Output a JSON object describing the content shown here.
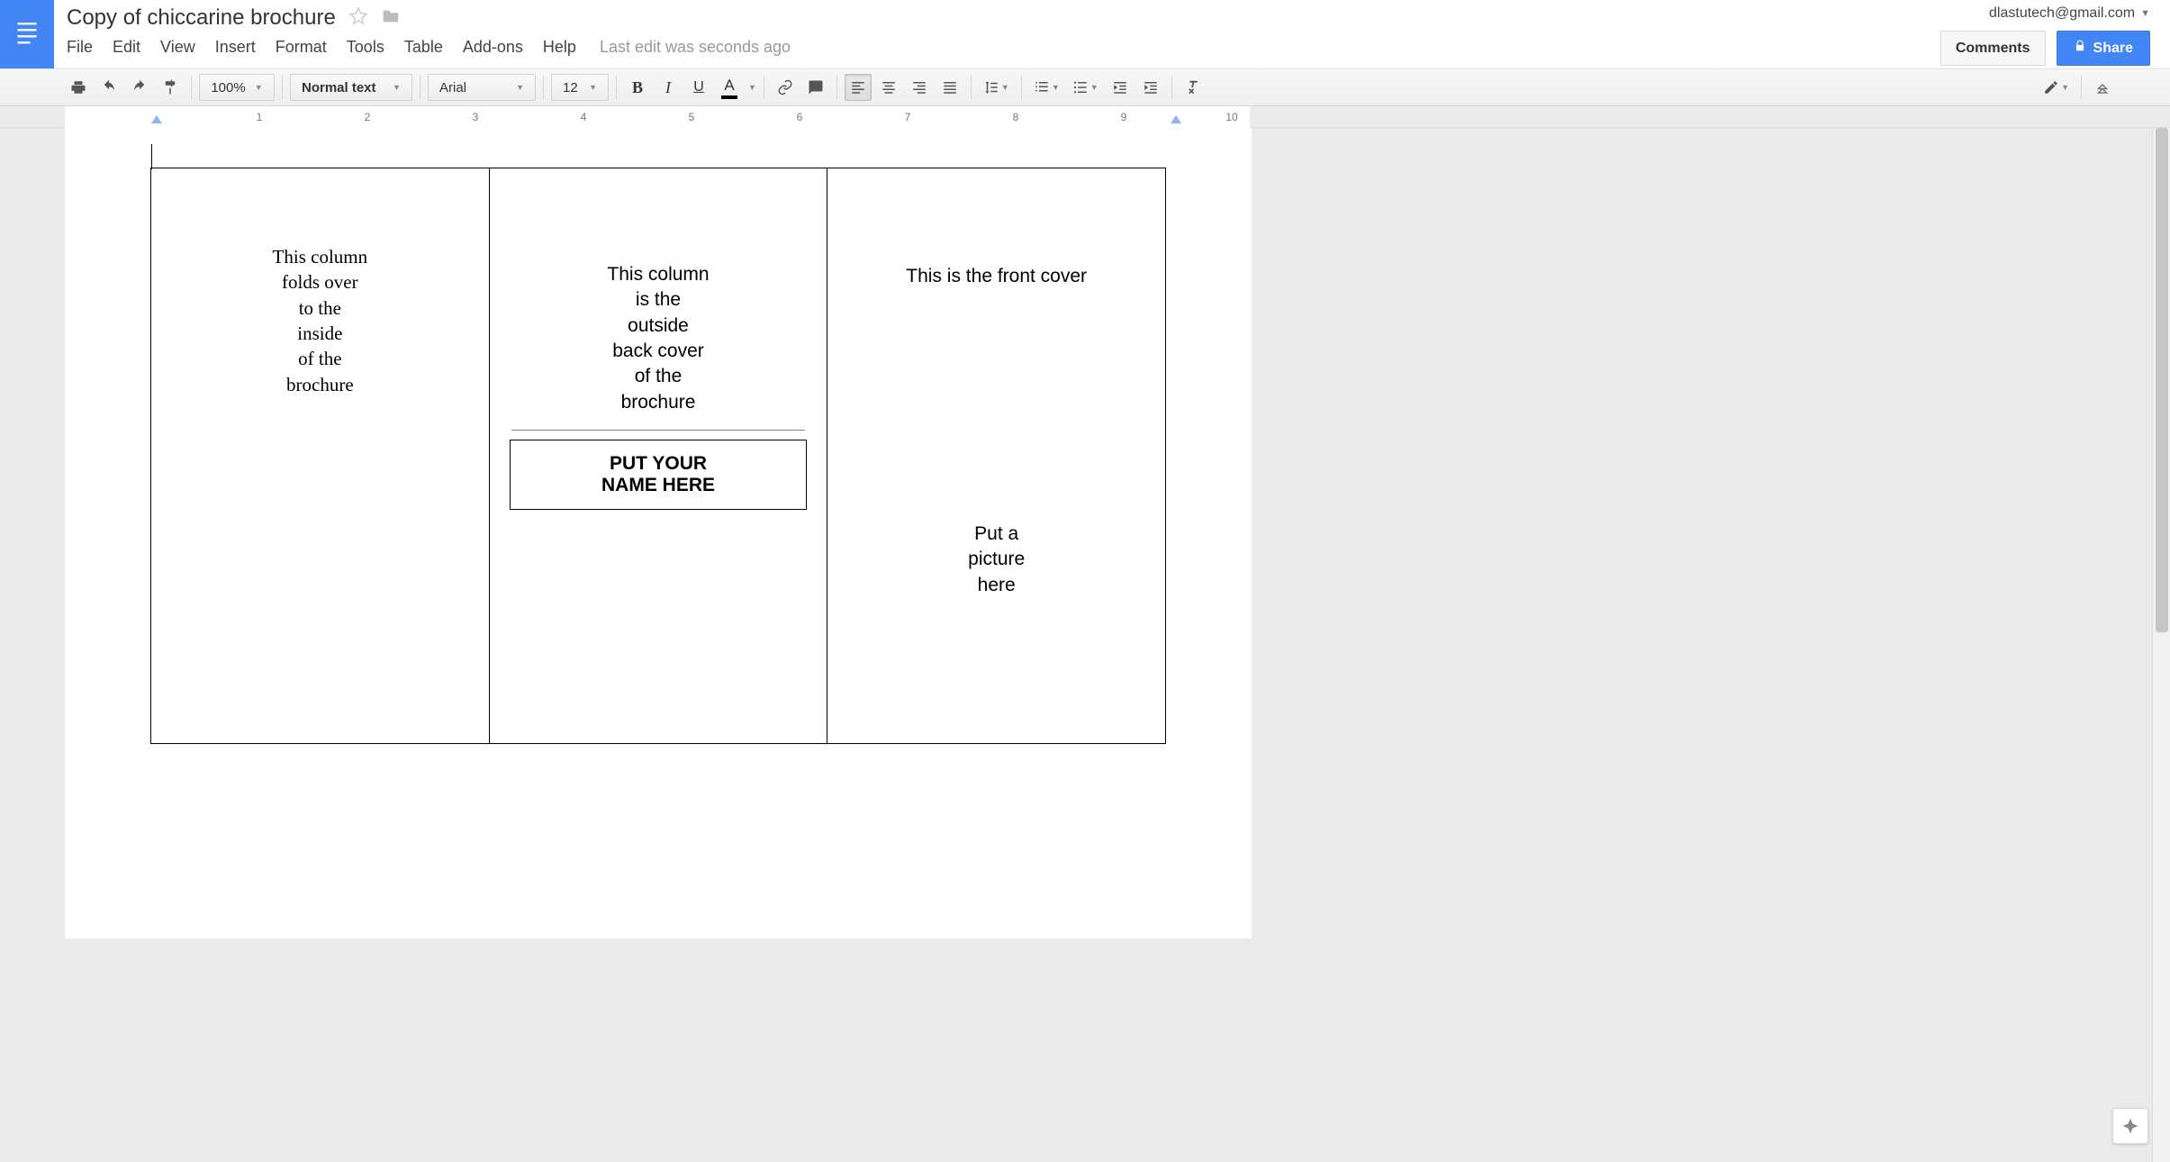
{
  "header": {
    "doc_title": "Copy of chiccarine brochure",
    "account_email": "dlastutech@gmail.com",
    "comments_label": "Comments",
    "share_label": "Share"
  },
  "menubar": {
    "file": "File",
    "edit": "Edit",
    "view": "View",
    "insert": "Insert",
    "format": "Format",
    "tools": "Tools",
    "table": "Table",
    "addons": "Add-ons",
    "help": "Help",
    "last_edit": "Last edit was seconds ago"
  },
  "toolbar": {
    "zoom": "100%",
    "paragraph_style": "Normal text",
    "font": "Arial",
    "font_size": "12",
    "bold": "B",
    "italic": "I",
    "underline": "U",
    "text_color_letter": "A"
  },
  "ruler": {
    "ticks": [
      "1",
      "2",
      "3",
      "4",
      "5",
      "6",
      "7",
      "8",
      "9",
      "10"
    ]
  },
  "doc": {
    "panel1": {
      "l1": "This column",
      "l2": "folds over",
      "l3": "to the",
      "l4": "inside",
      "l5": "of the",
      "l6": "brochure"
    },
    "panel2": {
      "l1": "This column",
      "l2": "is the",
      "l3": "outside",
      "l4": "back cover",
      "l5": "of the",
      "l6": "brochure",
      "name1": "PUT YOUR",
      "name2": "NAME HERE"
    },
    "panel3": {
      "front": "This is the front cover",
      "pic1": "Put a",
      "pic2": "picture",
      "pic3": "here"
    }
  }
}
